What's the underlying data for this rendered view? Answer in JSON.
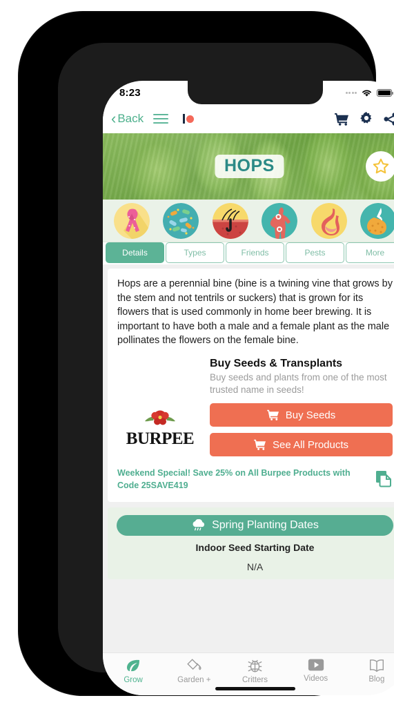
{
  "status_bar": {
    "time": "8:23",
    "wifi_icon": "wifi-icon",
    "battery_icon": "battery-icon",
    "signal_icon": "signal-dots-icon"
  },
  "nav": {
    "back_label": "Back",
    "back_icon": "chevron-left-icon",
    "menu_icon": "hamburger-menu-icon",
    "patreon_icon": "patreon-logo-icon",
    "cart_icon": "shopping-cart-icon",
    "settings_icon": "gear-icon",
    "share_icon": "share-icon"
  },
  "hero": {
    "title": "HOPS",
    "favorite_icon": "star-outline-icon"
  },
  "benefits": [
    {
      "name": "cancer-ribbon",
      "label": "Cancer Ribbon"
    },
    {
      "name": "microbiome",
      "label": "Bacteria"
    },
    {
      "name": "hair-follicle",
      "label": "Hair"
    },
    {
      "name": "body-pain",
      "label": "Pain Relief"
    },
    {
      "name": "stomach",
      "label": "Stomach"
    },
    {
      "name": "digestion",
      "label": "Digestion"
    }
  ],
  "tabs": [
    {
      "label": "Details",
      "active": true
    },
    {
      "label": "Types",
      "active": false
    },
    {
      "label": "Friends",
      "active": false
    },
    {
      "label": "Pests",
      "active": false
    },
    {
      "label": "More",
      "active": false
    }
  ],
  "details": {
    "description": "Hops are a perennial bine (bine is a twining vine that grows by the stem and not tentrils or suckers) that is grown for its flowers that is used commonly in home beer brewing. It is important to have both a male and a female plant as the male pollinates the flowers on the female bine."
  },
  "buy_section": {
    "heading": "Buy Seeds & Transplants",
    "subtitle": "Buy seeds and plants from one of the most trusted name in seeds!",
    "brand_name": "BURPEE",
    "brand_logo_icon": "burpee-flower-logo-icon",
    "buttons": [
      {
        "label": "Buy Seeds",
        "icon": "shopping-cart-icon"
      },
      {
        "label": "See All Products",
        "icon": "shopping-cart-icon"
      }
    ],
    "promo_text": "Weekend Special! Save 25% on All Burpee Products with Code 25SAVE419",
    "copy_icon": "copy-icon"
  },
  "planting": {
    "header_label": "Spring Planting Dates",
    "header_icon": "rain-cloud-icon",
    "subtitle": "Indoor Seed Starting Date",
    "value": "N/A"
  },
  "bottom_nav": [
    {
      "label": "Grow",
      "icon": "leaf-icon",
      "active": true
    },
    {
      "label": "Garden +",
      "icon": "watering-can-icon",
      "active": false
    },
    {
      "label": "Critters",
      "icon": "bug-icon",
      "active": false
    },
    {
      "label": "Videos",
      "icon": "play-button-icon",
      "active": false
    },
    {
      "label": "Blog",
      "icon": "open-book-icon",
      "active": false
    }
  ],
  "colors": {
    "brand_green": "#4fb38f",
    "tab_active": "#5cb396",
    "shop_button": "#ef6f52",
    "hero_title": "#2b8a86",
    "star": "#f5c33a"
  }
}
